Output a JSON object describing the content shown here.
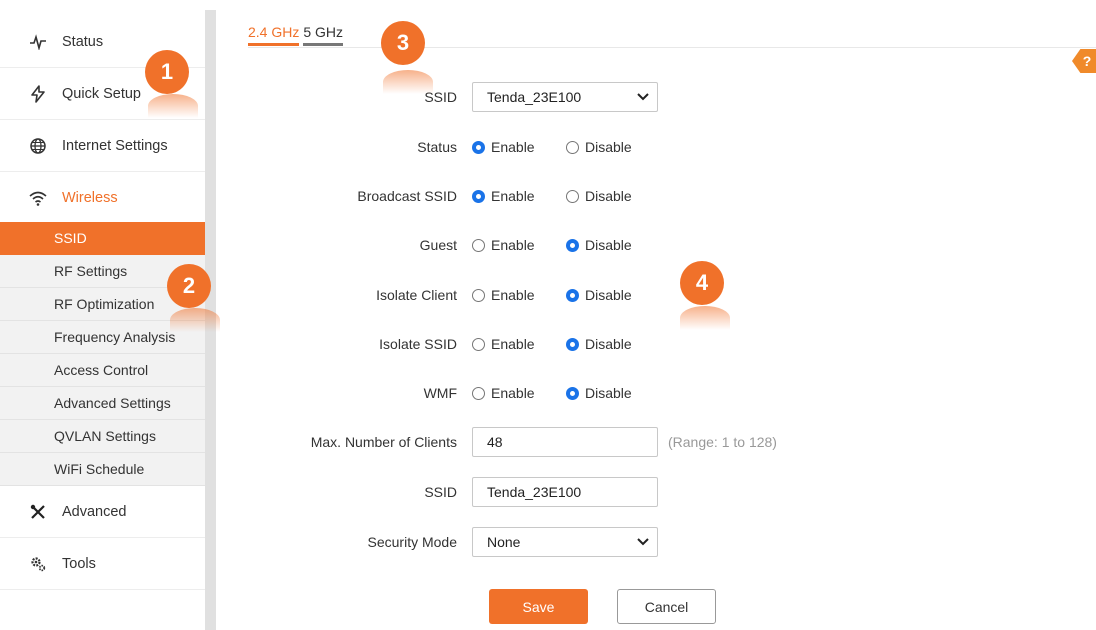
{
  "sidebar": {
    "items": [
      {
        "label": "Status",
        "icon": "pulse-icon"
      },
      {
        "label": "Quick Setup",
        "icon": "bolt-icon"
      },
      {
        "label": "Internet Settings",
        "icon": "globe-icon"
      },
      {
        "label": "Wireless",
        "icon": "wifi-icon"
      },
      {
        "label": "Advanced",
        "icon": "tools-cross-icon"
      },
      {
        "label": "Tools",
        "icon": "gears-icon"
      }
    ],
    "wireless_sub": [
      "SSID",
      "RF Settings",
      "RF Optimization",
      "Frequency Analysis",
      "Access Control",
      "Advanced Settings",
      "QVLAN Settings",
      "WiFi Schedule"
    ]
  },
  "badges": [
    "1",
    "2",
    "3",
    "4"
  ],
  "tabs": [
    "2.4 GHz",
    "5 GHz"
  ],
  "help": "?",
  "form": {
    "ssid_select_label": "SSID",
    "ssid_select_value": "Tenda_23E100",
    "status_label": "Status",
    "broadcast_label": "Broadcast SSID",
    "guest_label": "Guest",
    "isolate_client_label": "Isolate Client",
    "isolate_ssid_label": "Isolate SSID",
    "wmf_label": "WMF",
    "enable": "Enable",
    "disable": "Disable",
    "max_clients_label": "Max. Number of Clients",
    "max_clients_value": "48",
    "max_clients_hint": "(Range: 1 to 128)",
    "ssid_name_label": "SSID",
    "ssid_name_value": "Tenda_23E100",
    "security_label": "Security Mode",
    "security_value": "None"
  },
  "buttons": {
    "save": "Save",
    "cancel": "Cancel"
  },
  "colors": {
    "accent": "#f0712a",
    "radio_checked": "#1a73e8"
  }
}
